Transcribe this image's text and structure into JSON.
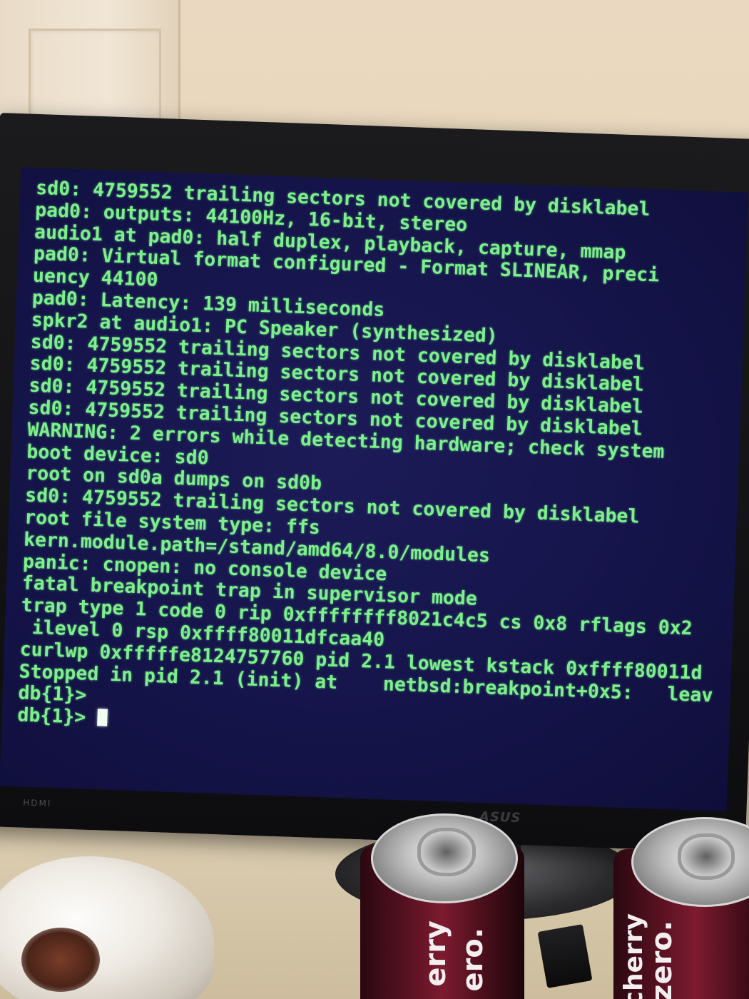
{
  "console": {
    "lines": [
      "sd0: 4759552 trailing sectors not covered by disklabel",
      "pad0: outputs: 44100Hz, 16-bit, stereo",
      "audio1 at pad0: half duplex, playback, capture, mmap",
      "pad0: Virtual format configured - Format SLINEAR, preci",
      "uency 44100",
      "pad0: Latency: 139 milliseconds",
      "spkr2 at audio1: PC Speaker (synthesized)",
      "sd0: 4759552 trailing sectors not covered by disklabel",
      "sd0: 4759552 trailing sectors not covered by disklabel",
      "sd0: 4759552 trailing sectors not covered by disklabel",
      "sd0: 4759552 trailing sectors not covered by disklabel",
      "WARNING: 2 errors while detecting hardware; check system",
      "boot device: sd0",
      "root on sd0a dumps on sd0b",
      "sd0: 4759552 trailing sectors not covered by disklabel",
      "root file system type: ffs",
      "kern.module.path=/stand/amd64/8.0/modules",
      "panic: cnopen: no console device",
      "fatal breakpoint trap in supervisor mode",
      "trap type 1 code 0 rip 0xffffffff8021c4c5 cs 0x8 rflags 0x2",
      " ilevel 0 rsp 0xffff80011dfcaa40",
      "curlwp 0xfffffe8124757760 pid 2.1 lowest kstack 0xffff80011d",
      "Stopped in pid 2.1 (init) at    netbsd:breakpoint+0x5:   leav",
      "db{1}>"
    ],
    "prompt": "db{1}> ",
    "text_color": "#7cf08a",
    "background_color": "#15144a"
  },
  "monitor": {
    "brand": "ASUS",
    "port_label": "HDMI"
  },
  "cans": [
    {
      "label": "erry",
      "label2": "ero."
    },
    {
      "label": "cherry",
      "label2": "zero."
    }
  ]
}
